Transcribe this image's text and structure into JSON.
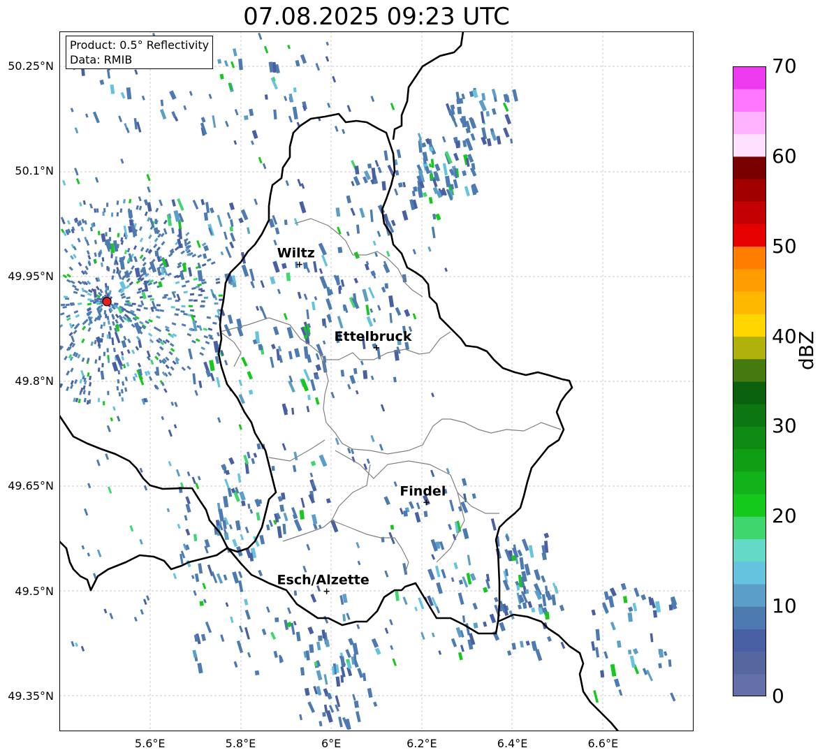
{
  "title": "07.08.2025 09:23 UTC",
  "info": {
    "product": "Product: 0.5° Reflectivity",
    "source": "Data: RMIB"
  },
  "map": {
    "lon_range": [
      5.4,
      6.8
    ],
    "lat_range": [
      49.3,
      50.3
    ],
    "lat_ticks": [
      "50.25°N",
      "50.1°N",
      "49.95°N",
      "49.8°N",
      "49.65°N",
      "49.5°N",
      "49.35°N"
    ],
    "lon_ticks": [
      "5.6°E",
      "5.8°E",
      "6°E",
      "6.2°E",
      "6.4°E",
      "6.6°E"
    ],
    "cities": [
      {
        "name": "Wiltz",
        "lon": 5.93,
        "lat": 49.967
      },
      {
        "name": "Ettelbruck",
        "lon": 6.1,
        "lat": 49.848
      },
      {
        "name": "Findel",
        "lon": 6.21,
        "lat": 49.627
      },
      {
        "name": "Esch/Alzette",
        "lon": 5.99,
        "lat": 49.5
      }
    ],
    "radar_site": {
      "lon": 5.505,
      "lat": 49.914
    }
  },
  "colorbar": {
    "label": "dBZ",
    "ticks": [
      "0",
      "10",
      "20",
      "30",
      "40",
      "50",
      "60",
      "70"
    ],
    "colors": [
      "#646ea8",
      "#56679f",
      "#4860a3",
      "#4e7ab2",
      "#5b9ec8",
      "#66c3df",
      "#64d9c7",
      "#3fd66d",
      "#14c81c",
      "#12b31a",
      "#109e14",
      "#0e8a12",
      "#0c7610",
      "#0a620d",
      "#447a10",
      "#b0b10a",
      "#ffd600",
      "#ffb800",
      "#ff9c00",
      "#ff7d00",
      "#e60000",
      "#c40000",
      "#a00000",
      "#7a0000",
      "#ffe0ff",
      "#ffb3ff",
      "#ff77ff",
      "#ee3aee"
    ]
  }
}
